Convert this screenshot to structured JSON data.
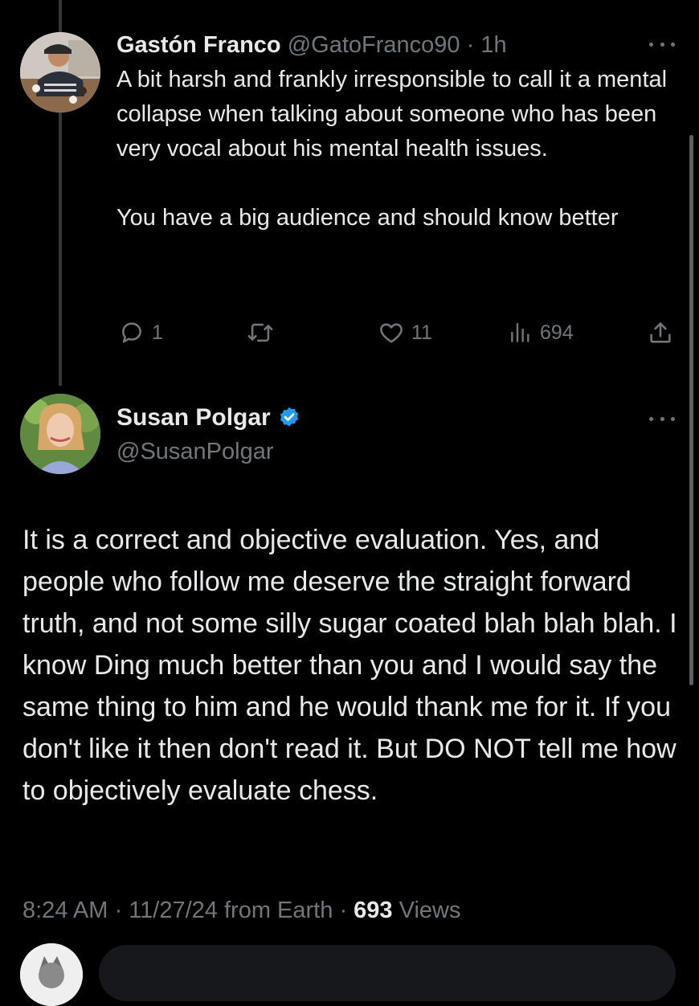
{
  "reply_tweet": {
    "name": "Gastón Franco",
    "handle": "@GatoFranco90",
    "separator": "·",
    "time": "1h",
    "paragraphs": [
      "A bit harsh and frankly irresponsible to call it a mental collapse when talking about someone who has been very vocal about his mental health issues.",
      "You have a big audience and should know better"
    ],
    "replies": "1",
    "likes": "11",
    "views": "694"
  },
  "main_tweet": {
    "name": "Susan Polgar",
    "handle": "@SusanPolgar",
    "verified": true,
    "body": "It is a correct and objective evaluation. Yes, and people who follow me deserve the straight forward truth, and not some silly sugar coated blah blah blah. I know Ding much better than you and I would say the same thing to him and he would thank me for it. If you don't like it then don't read it. But DO NOT tell me how to objectively evaluate chess.",
    "time": "8:24 AM",
    "separator_1": "·",
    "date": "11/27/24",
    "source": "from Earth",
    "separator_2": "·",
    "views_count": "693",
    "views_label": "Views"
  },
  "colors": {
    "background": "#000000",
    "text": "#e7e9ea",
    "muted": "#71767b",
    "verified": "#1d9bf0",
    "thread_line": "#333639"
  },
  "icons": {
    "reply": "comment-bubble-icon",
    "retweet": "retweet-icon",
    "like": "heart-icon",
    "views": "bar-chart-icon",
    "share": "share-icon",
    "more": "more-dots-icon",
    "verified": "verified-badge-icon"
  }
}
